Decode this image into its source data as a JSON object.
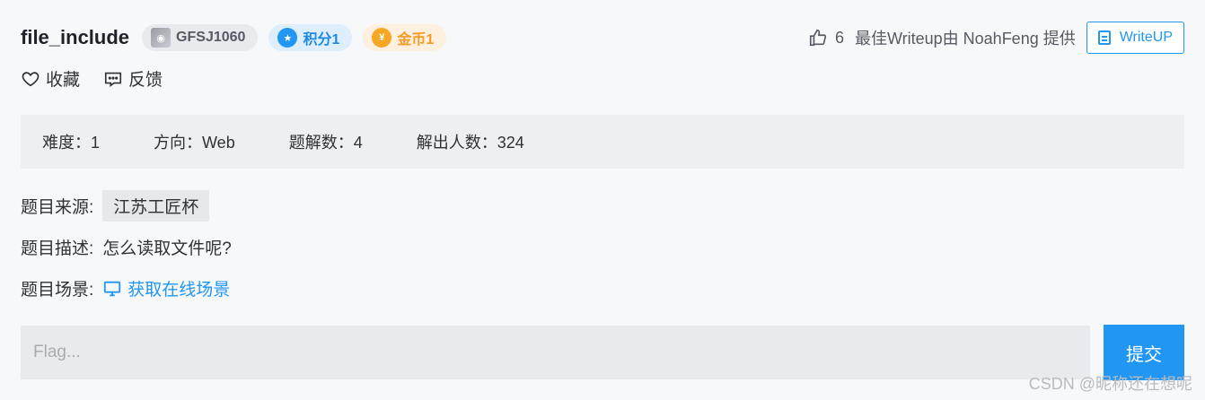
{
  "challenge": {
    "title": "file_include",
    "badges": {
      "id": "GFSJ1060",
      "score": "积分1",
      "coin": "金币1"
    }
  },
  "header_right": {
    "likes": "6",
    "writeup_text": "最佳Writeup由 NoahFeng 提供",
    "writeup_button": "WriteUP"
  },
  "actions": {
    "favorite": "收藏",
    "feedback": "反馈"
  },
  "stats": {
    "difficulty": "难度：1",
    "direction": "方向：Web",
    "solutions": "题解数：4",
    "solvers": "解出人数：324"
  },
  "info": {
    "source_label": "题目来源:",
    "source_value": "江苏工匠杯",
    "desc_label": "题目描述:",
    "desc_value": "怎么读取文件呢?",
    "scene_label": "题目场景:",
    "scene_link": "获取在线场景"
  },
  "flag": {
    "placeholder": "Flag...",
    "submit": "提交"
  },
  "watermark": "CSDN @昵称还在想呢",
  "colors": {
    "accent": "#2196f3",
    "coin": "#f5a623",
    "background": "#f7f8fa"
  },
  "icons": [
    "thumbs-up-icon",
    "document-icon",
    "heart-icon",
    "comment-icon",
    "monitor-icon",
    "badge-id-icon",
    "badge-score-icon",
    "badge-coin-icon"
  ]
}
